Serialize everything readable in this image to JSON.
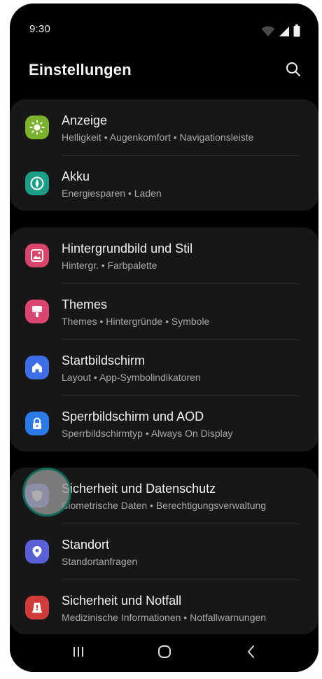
{
  "status_bar": {
    "time": "9:30",
    "icons": [
      "wifi-icon",
      "signal-icon",
      "battery-icon"
    ]
  },
  "header": {
    "title": "Einstellungen",
    "search_icon": "search-icon"
  },
  "groups": [
    {
      "items": [
        {
          "title": "Anzeige",
          "subtitle": "Helligkeit • Augenkomfort • Navigationsleiste",
          "icon": "sun-icon",
          "color": "#7cb22d"
        },
        {
          "title": "Akku",
          "subtitle": "Energiesparen • Laden",
          "icon": "battery-charge-icon",
          "color": "#1b9e85"
        }
      ]
    },
    {
      "items": [
        {
          "title": "Hintergrundbild und Stil",
          "subtitle": "Hintergr. • Farbpalette",
          "icon": "image-icon",
          "color": "#d9446a"
        },
        {
          "title": "Themes",
          "subtitle": "Themes • Hintergründe • Symbole",
          "icon": "brush-icon",
          "color": "#db4670"
        },
        {
          "title": "Startbildschirm",
          "subtitle": "Layout • App-Symbolindikatoren",
          "icon": "home-icon",
          "color": "#3d6ee6"
        },
        {
          "title": "Sperrbildschirm und AOD",
          "subtitle": "Sperrbildschirmtyp • Always On Display",
          "icon": "lock-icon",
          "color": "#2a7be6"
        }
      ]
    },
    {
      "items": [
        {
          "title": "Sicherheit und Datenschutz",
          "subtitle": "Biometrische Daten • Berechtigungsverwaltung",
          "icon": "shield-icon",
          "color": "#6a74d8"
        },
        {
          "title": "Standort",
          "subtitle": "Standortanfragen",
          "icon": "location-pin-icon",
          "color": "#5a5fd6"
        },
        {
          "title": "Sicherheit und Notfall",
          "subtitle": "Medizinische Informationen • Notfallwarnungen",
          "icon": "emergency-icon",
          "color": "#cf3c3a"
        }
      ]
    }
  ],
  "nav_bar": {
    "recents_icon": "recents-icon",
    "home_icon": "home-button-icon",
    "back_icon": "back-icon"
  }
}
